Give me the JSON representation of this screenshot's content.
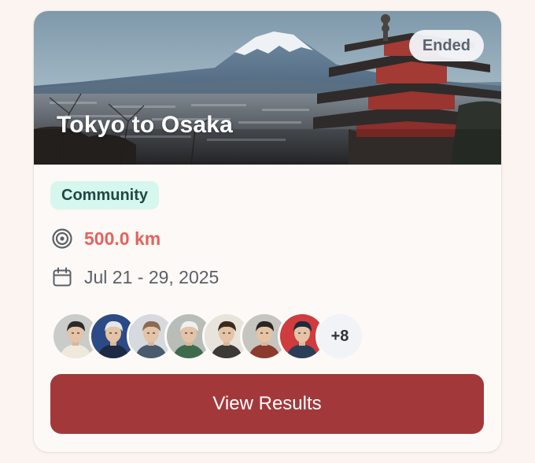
{
  "event": {
    "title": "Tokyo to Osaka",
    "status": "Ended",
    "category": "Community",
    "distance": "500.0 km",
    "dates": "Jul 21 - 29, 2025",
    "hero_image": "mount-fuji-pagoda-photo"
  },
  "participants": {
    "more_count": "+8",
    "avatars": [
      {
        "name": "avatar-1",
        "bg": "#c9ccc8",
        "hair": "#2b2b2b",
        "shirt": "#efe9dc"
      },
      {
        "name": "avatar-2",
        "bg": "#2c4a86",
        "hair": "#e3e6ea",
        "shirt": "#1d2a44"
      },
      {
        "name": "avatar-3",
        "bg": "#d6dade",
        "hair": "#8a6b52",
        "shirt": "#4b5b6e"
      },
      {
        "name": "avatar-4",
        "bg": "#b9bdb8",
        "hair": "#eef0f2",
        "shirt": "#3e6b4c"
      },
      {
        "name": "avatar-5",
        "bg": "#e8e4dc",
        "hair": "#3a2a1e",
        "shirt": "#3b3a36"
      },
      {
        "name": "avatar-6",
        "bg": "#c7c5bf",
        "hair": "#2a2622",
        "shirt": "#8a3b2e"
      },
      {
        "name": "avatar-7",
        "bg": "#cf3b3e",
        "hair": "#1b2a3c",
        "shirt": "#2c3e57"
      }
    ]
  },
  "actions": {
    "view_results_label": "View Results"
  },
  "colors": {
    "accent": "#a3383b",
    "distance": "#e06460",
    "tag_bg": "#d6f7ee",
    "tag_text": "#1f4a40"
  },
  "icons": {
    "distance": "target-icon",
    "dates": "calendar-icon"
  }
}
